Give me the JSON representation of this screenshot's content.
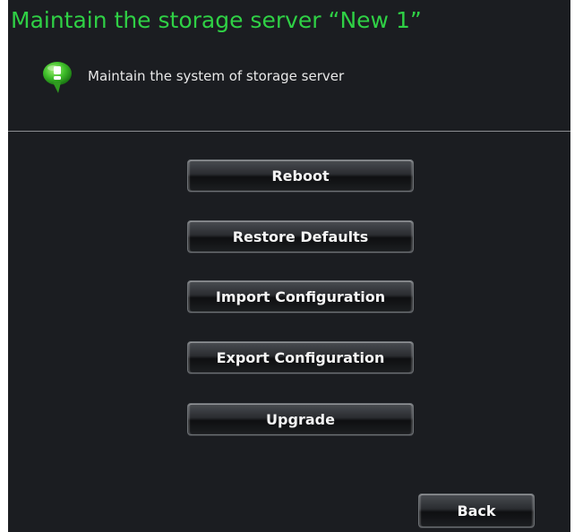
{
  "dialog": {
    "title": "Maintain the storage server  “New 1”",
    "info_text": "Maintain the system of storage server",
    "accent_color": "#2fd045"
  },
  "buttons": {
    "reboot": "Reboot",
    "restore_defaults": "Restore Defaults",
    "import_configuration": "Import Configuration",
    "export_configuration": "Export Configuration",
    "upgrade": "Upgrade",
    "back": "Back"
  },
  "icons": {
    "info": "green-speech-bubble-icon"
  }
}
